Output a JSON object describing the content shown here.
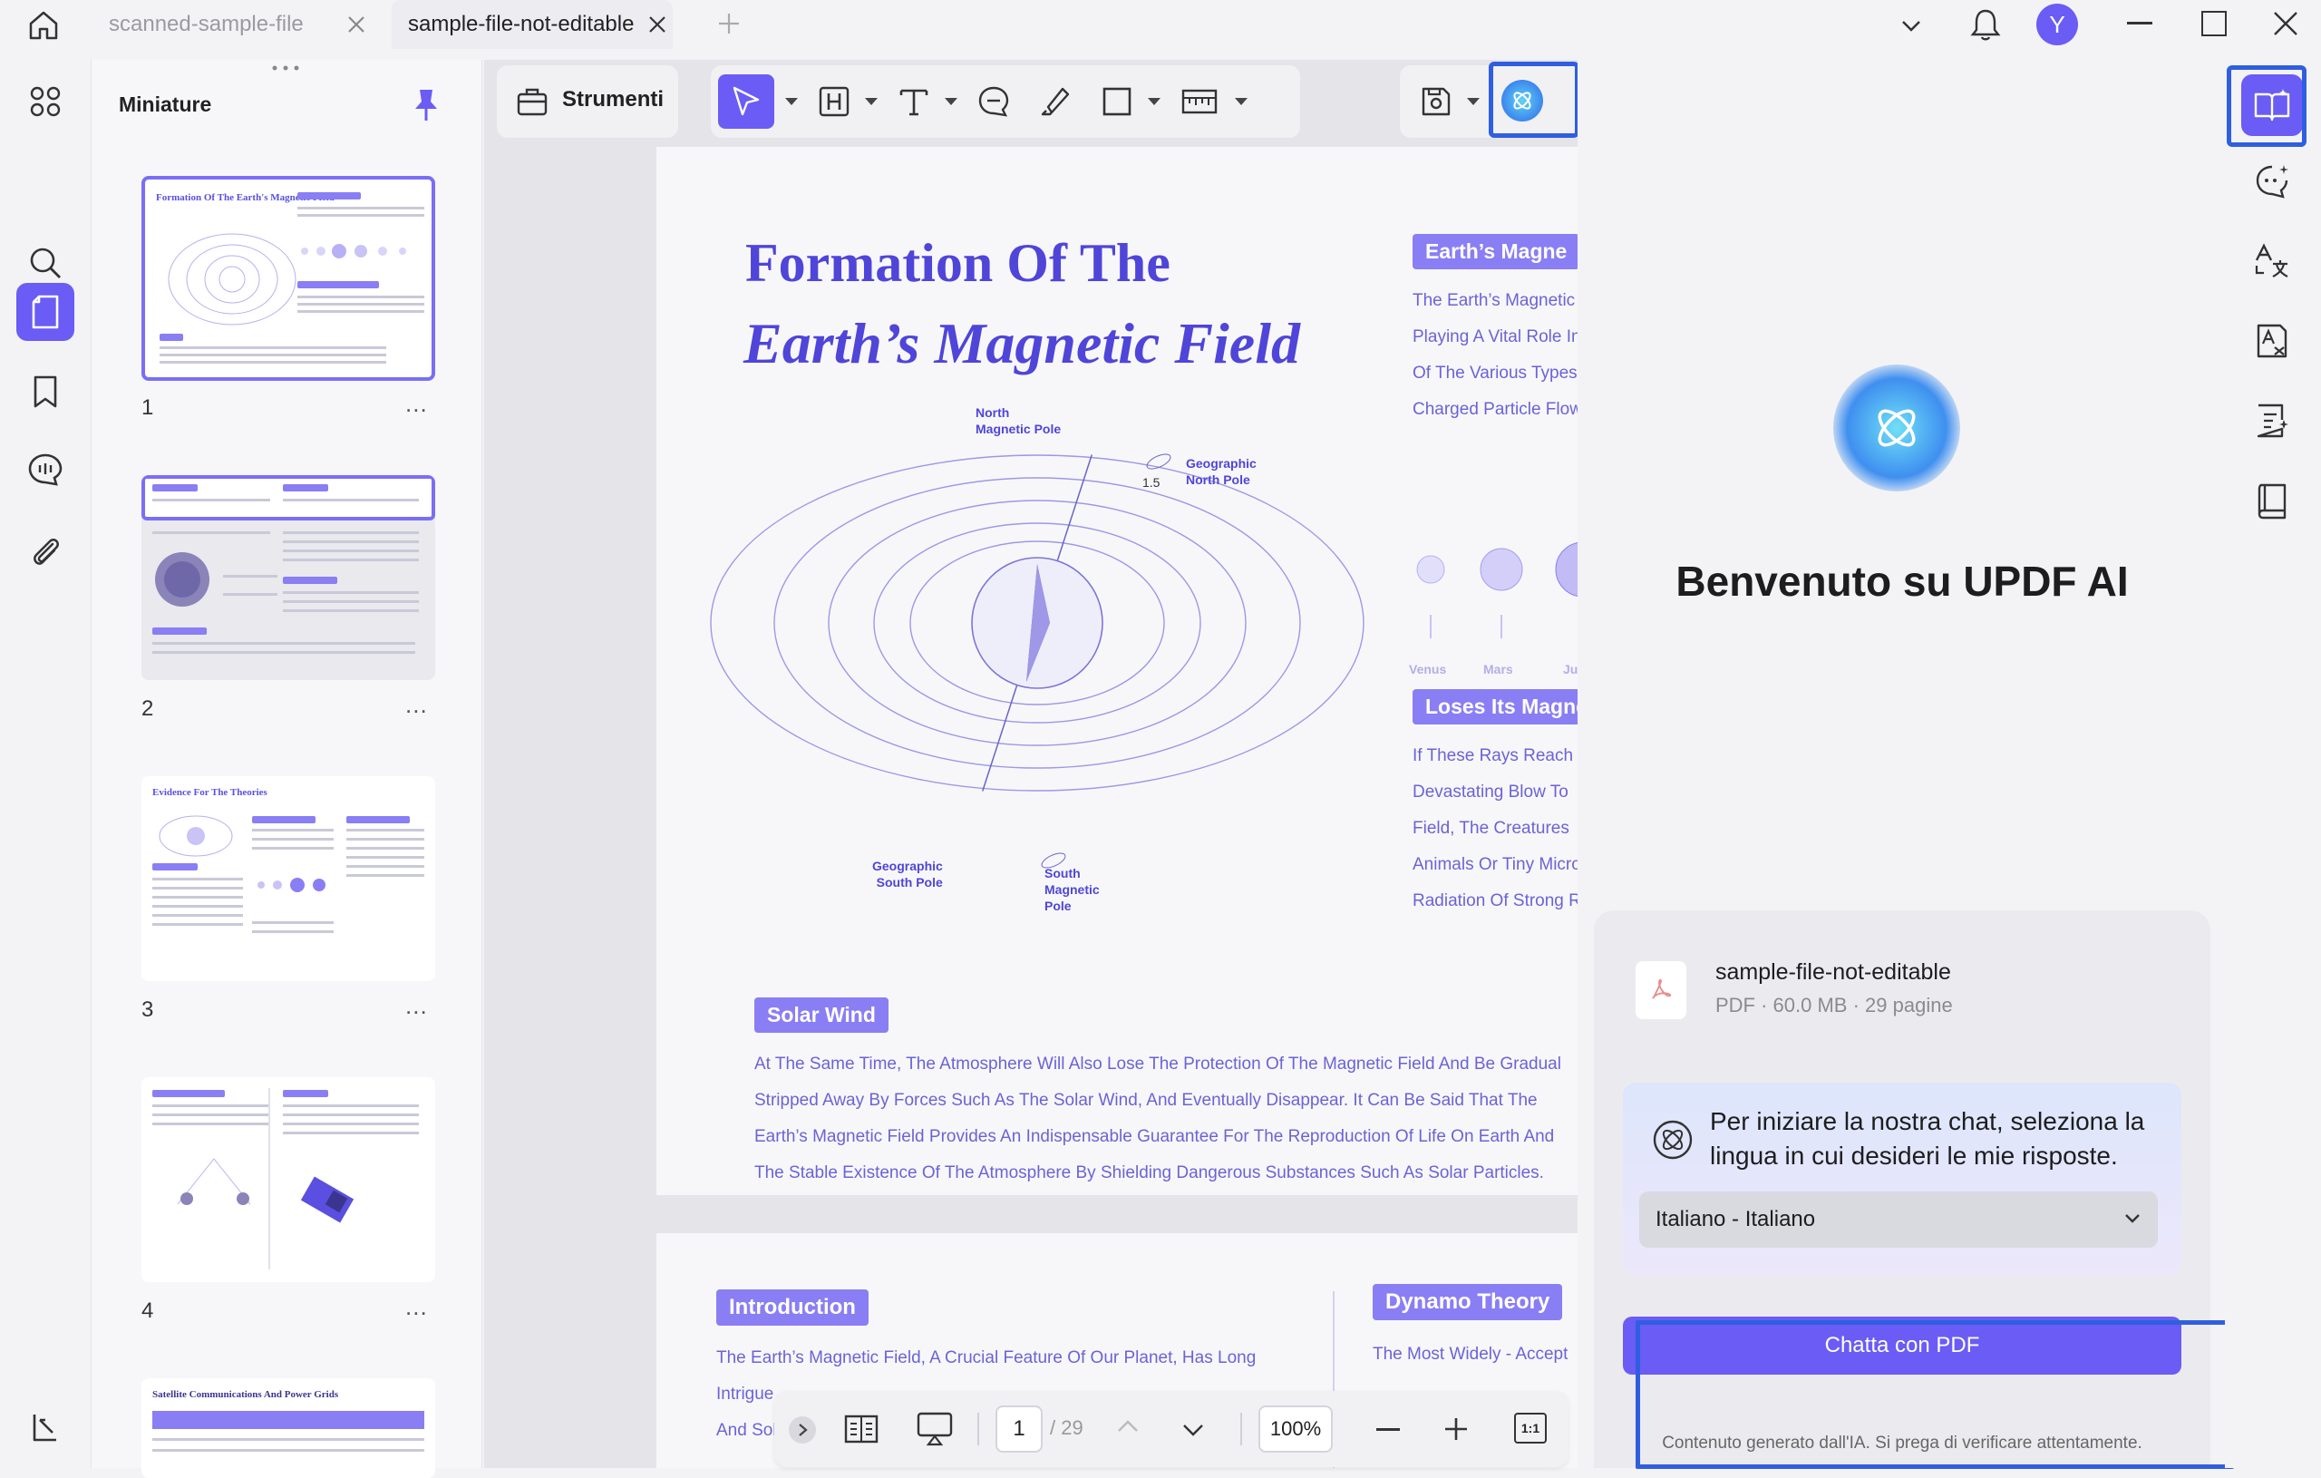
{
  "tabs": [
    {
      "label": "scanned-sample-file",
      "active": false
    },
    {
      "label": "sample-file-not-editable",
      "active": true
    }
  ],
  "user_initial": "Y",
  "thumbnails": {
    "title": "Miniature",
    "pages": [
      "1",
      "2",
      "3",
      "4"
    ],
    "more": "...",
    "page5_title": "Satellite Communications And Power Grids",
    "page3_title": "Evidence For The Theories",
    "page1_title": "Formation Of The Earth's Magnetic Field"
  },
  "toolbar": {
    "tools_label": "Strumenti"
  },
  "document": {
    "title_line1": "Formation Of The",
    "title_line2": "Earth’s Magnetic Field",
    "diagram_labels": {
      "north_magnetic_pole": [
        "North",
        "Magnetic Pole"
      ],
      "geographic_north_pole": [
        "Geographic",
        "North Pole"
      ],
      "angle": "1.5",
      "geographic_south_pole": [
        "Geographic",
        "South Pole"
      ],
      "south_magnetic_pole": [
        "South",
        "Magnetic",
        "Pole"
      ]
    },
    "right_label1": "Earth’s Magne",
    "right_text1": [
      "The Earth’s Magnetic",
      "Playing A Vital Role In",
      "Of The Various Types",
      "Charged Particle Flow"
    ],
    "planets": [
      "Venus",
      "Mars",
      "Ju"
    ],
    "right_label2": "Loses Its Magne",
    "right_text2": [
      "If These Rays Reach",
      "Devastating Blow To",
      "Field, The Creatures",
      "Animals Or Tiny Micro",
      "Radiation Of Strong R"
    ],
    "solar_wind_label": "Solar Wind",
    "solar_wind_text": [
      "At The Same Time, The Atmosphere Will Also Lose The Protection Of The Magnetic Field And Be Gradual",
      "Stripped Away By Forces Such As The Solar Wind, And Eventually Disappear. It Can Be Said That The",
      "Earth’s Magnetic Field Provides An Indispensable Guarantee For The Reproduction Of Life On Earth And",
      "The Stable Existence Of The Atmosphere By Shielding Dangerous Substances Such As Solar Particles."
    ],
    "intro_label": "Introduction",
    "intro_text": [
      "The Earth’s Magnetic Field, A Crucial Feature Of Our Planet, Has Long",
      "Intrigue",
      "And Sol"
    ],
    "dynamo_label": "Dynamo Theory",
    "dynamo_text": "The Most Widely - Accept"
  },
  "bottom_nav": {
    "current_page": "1",
    "total_pages": "/ 29",
    "zoom": "100%",
    "fit_label": "1:1"
  },
  "ai": {
    "welcome": "Benvenuto su UPDF AI",
    "file_name": "sample-file-not-editable",
    "file_meta": "PDF · 60.0 MB · 29 pagine",
    "prompt": [
      "Per iniziare la nostra chat, seleziona la",
      "lingua in cui desideri le mie risposte."
    ],
    "language_selected": "Italiano - Italiano",
    "chat_button": "Chatta con PDF",
    "disclaimer": "Contenuto generato dall'IA. Si prega di verificare attentamente."
  },
  "colors": {
    "accent": "#6a5cf4",
    "doc_purple": "#5a4fe0",
    "highlight_blue": "#2f5fe0"
  }
}
